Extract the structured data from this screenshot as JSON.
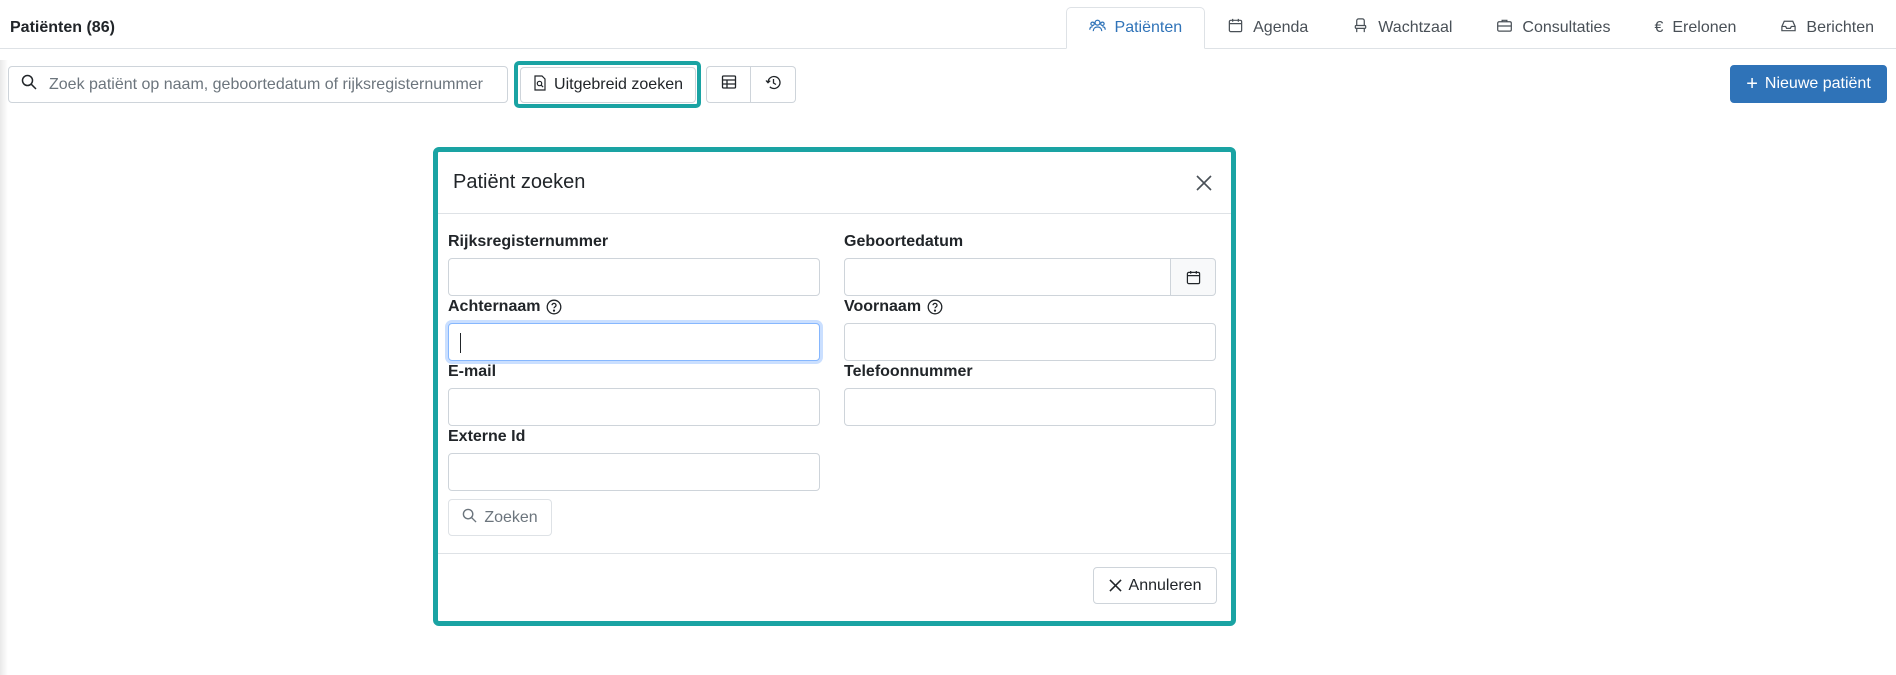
{
  "header": {
    "title": "Patiënten (86)",
    "tabs": [
      {
        "label": "Patiënten",
        "icon": "users-icon",
        "active": true
      },
      {
        "label": "Agenda",
        "icon": "calendar-icon",
        "active": false
      },
      {
        "label": "Wachtzaal",
        "icon": "chair-icon",
        "active": false
      },
      {
        "label": "Consultaties",
        "icon": "briefcase-icon",
        "active": false
      },
      {
        "label": "Erelonen",
        "icon": "euro-icon",
        "active": false
      },
      {
        "label": "Berichten",
        "icon": "inbox-icon",
        "active": false
      }
    ]
  },
  "toolbar": {
    "search_placeholder": "Zoek patiënt op naam, geboortedatum of rijksregisternummer",
    "advanced_search_label": "Uitgebreid zoeken",
    "new_patient_label": "Nieuwe patiënt"
  },
  "modal": {
    "title": "Patiënt zoeken",
    "fields": {
      "rijksregisternummer": {
        "label": "Rijksregisternummer",
        "value": ""
      },
      "geboortedatum": {
        "label": "Geboortedatum",
        "value": ""
      },
      "achternaam": {
        "label": "Achternaam",
        "value": ""
      },
      "voornaam": {
        "label": "Voornaam",
        "value": ""
      },
      "email": {
        "label": "E-mail",
        "value": ""
      },
      "telefoonnummer": {
        "label": "Telefoonnummer",
        "value": ""
      },
      "externe_id": {
        "label": "Externe Id",
        "value": ""
      }
    },
    "search_button_label": "Zoeken",
    "cancel_button_label": "Annuleren"
  },
  "colors": {
    "primary": "#2f73b8",
    "highlight": "#1aa3a3",
    "focus_border": "#86b7fe"
  }
}
